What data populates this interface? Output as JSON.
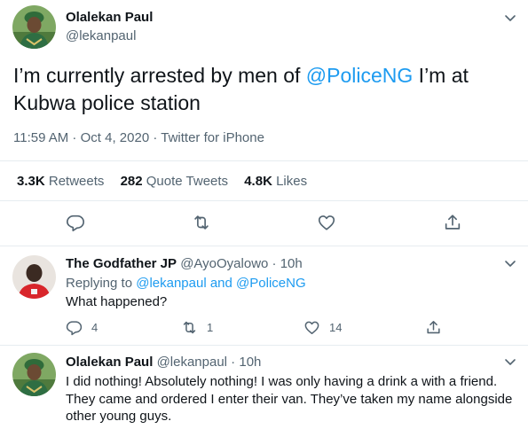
{
  "main_tweet": {
    "author_name": "Olalekan Paul",
    "author_handle": "@lekanpaul",
    "text_before": "I’m currently arrested by men of ",
    "text_mention": "@PoliceNG",
    "text_after": " I’m at Kubwa police station",
    "time": "11:59 AM",
    "dot1": " · ",
    "date": "Oct 4, 2020",
    "dot2": " · ",
    "source": "Twitter for iPhone",
    "stats": {
      "retweets_count": "3.3K",
      "retweets_label": "Retweets",
      "quotes_count": "282",
      "quotes_label": "Quote Tweets",
      "likes_count": "4.8K",
      "likes_label": "Likes"
    },
    "actions": [
      "reply-icon",
      "retweet-icon",
      "like-icon",
      "share-icon"
    ]
  },
  "replies": [
    {
      "author_name": "The Godfather JP",
      "author_handle": "@AyoOyalowo",
      "time_sep": " · ",
      "time": "10h",
      "replying_prefix": "Replying to ",
      "replying_user1": "@lekanpaul",
      "replying_and": " and ",
      "replying_user2": "@PoliceNG",
      "text": "What happened?",
      "reply_count": "4",
      "retweet_count": "1",
      "like_count": "14"
    },
    {
      "author_name": "Olalekan Paul",
      "author_handle": "@lekanpaul",
      "time_sep": " · ",
      "time": "10h",
      "text": "I did nothing! Absolutely nothing! I was only having a drink a with a friend. They came and ordered I enter their van. They’ve taken my name alongside other young guys."
    }
  ],
  "colors": {
    "link": "#1d9bf0",
    "muted": "#536471",
    "text": "#0f1419",
    "divider": "#e6ecf0"
  }
}
